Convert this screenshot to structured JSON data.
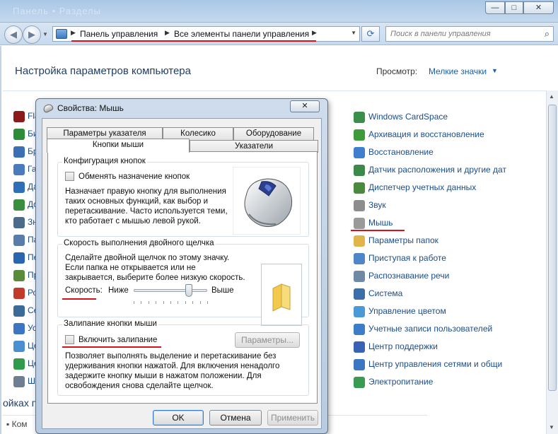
{
  "titlebar": {
    "ghost_text": "Панель • Разделы",
    "minimize_glyph": "—",
    "maximize_glyph": "□",
    "close_glyph": "✕"
  },
  "nav": {
    "back_glyph": "◀",
    "forward_glyph": "▶",
    "breadcrumbs": [
      "Панель управления",
      "Все элементы панели управления"
    ],
    "refresh_glyph": "⟳",
    "search_placeholder": "Поиск в панели управления"
  },
  "main": {
    "title": "Настройка параметров компьютера",
    "view_label": "Просмотр:",
    "view_value": "Мелкие значки",
    "bottom_heading": "ойках п",
    "bottom_item": "Ком"
  },
  "left_items": [
    {
      "label": "Fla",
      "color": "#8b1a1a"
    },
    {
      "label": "Би",
      "color": "#2e8b3a"
    },
    {
      "label": "Бр",
      "color": "#3b6fb6"
    },
    {
      "label": "Га",
      "color": "#4a7bbd"
    },
    {
      "label": "Да",
      "color": "#2f6fba"
    },
    {
      "label": "Дс",
      "color": "#3a8f3f"
    },
    {
      "label": "Зн",
      "color": "#4b6a8c"
    },
    {
      "label": "Па",
      "color": "#5a7ca8"
    },
    {
      "label": "Пе",
      "color": "#2a66b0"
    },
    {
      "label": "Пр",
      "color": "#5a8a3a"
    },
    {
      "label": "Ро",
      "color": "#c23a2a"
    },
    {
      "label": "Се",
      "color": "#3d6b99"
    },
    {
      "label": "Ус",
      "color": "#3c75c2"
    },
    {
      "label": "Це",
      "color": "#4a8fd0"
    },
    {
      "label": "Це",
      "color": "#2f9b4b"
    },
    {
      "label": "Ш",
      "color": "#6e7f92"
    }
  ],
  "right_items": [
    {
      "label": "Windows CardSpace",
      "color": "#3b8f4a"
    },
    {
      "label": "Архивация и восстановление",
      "color": "#3f9a3a"
    },
    {
      "label": "Восстановление",
      "color": "#3f7fd0"
    },
    {
      "label": "Датчик расположения и другие дат",
      "color": "#3b8a4a"
    },
    {
      "label": "Диспетчер учетных данных",
      "color": "#4a8a3c"
    },
    {
      "label": "Звук",
      "color": "#8d8d8d"
    },
    {
      "label": "Мышь",
      "color": "#9a9a9a"
    },
    {
      "label": "Параметры папок",
      "color": "#e0b64a"
    },
    {
      "label": "Приступая к работе",
      "color": "#4f85c9"
    },
    {
      "label": "Распознавание речи",
      "color": "#6f8aa5"
    },
    {
      "label": "Система",
      "color": "#3c6ea8"
    },
    {
      "label": "Управление цветом",
      "color": "#4a9ad6"
    },
    {
      "label": "Учетные записи пользователей",
      "color": "#3d7cc6"
    },
    {
      "label": "Центр поддержки",
      "color": "#3a62b4"
    },
    {
      "label": "Центр управления сетями и общи",
      "color": "#3b77c0"
    },
    {
      "label": "Электропитание",
      "color": "#3b9a52"
    }
  ],
  "dialog": {
    "title": "Свойства: Мышь",
    "close_glyph": "✕",
    "tabs_row1": [
      "Параметры указателя",
      "Колесико",
      "Оборудование"
    ],
    "tabs_row2": [
      "Кнопки мыши",
      "Указатели"
    ],
    "button_config": {
      "group_label": "Конфигурация кнопок",
      "checkbox_label": "Обменять назначение кнопок",
      "desc": [
        "Назначает правую кнопку для выполнения",
        "таких основных функций, как выбор и",
        "перетаскивание. Часто используется теми,",
        "кто работает с мышью левой рукой."
      ]
    },
    "dblclick": {
      "group_label": "Скорость выполнения двойного щелчка",
      "desc": [
        "Сделайте двойной щелчок по этому значку.",
        "Если папка не открывается или не",
        "закрывается, выберите более низкую скорость."
      ],
      "speed_label": "Скорость:",
      "low_label": "Ниже",
      "high_label": "Выше",
      "speed_level": 0.75
    },
    "clicklock": {
      "group_label": "Залипание кнопки мыши",
      "checkbox_label": "Включить залипание",
      "settings_button": "Параметры...",
      "desc": [
        "Позволяет выполнять выделение и перетаскивание без",
        "удерживания кнопки нажатой. Для включения ненадолго",
        "задержите кнопку мыши в нажатом положении. Для",
        "освобождения снова сделайте щелчок."
      ]
    },
    "buttons": {
      "ok": "OK",
      "cancel": "Отмена",
      "apply": "Применить"
    }
  }
}
